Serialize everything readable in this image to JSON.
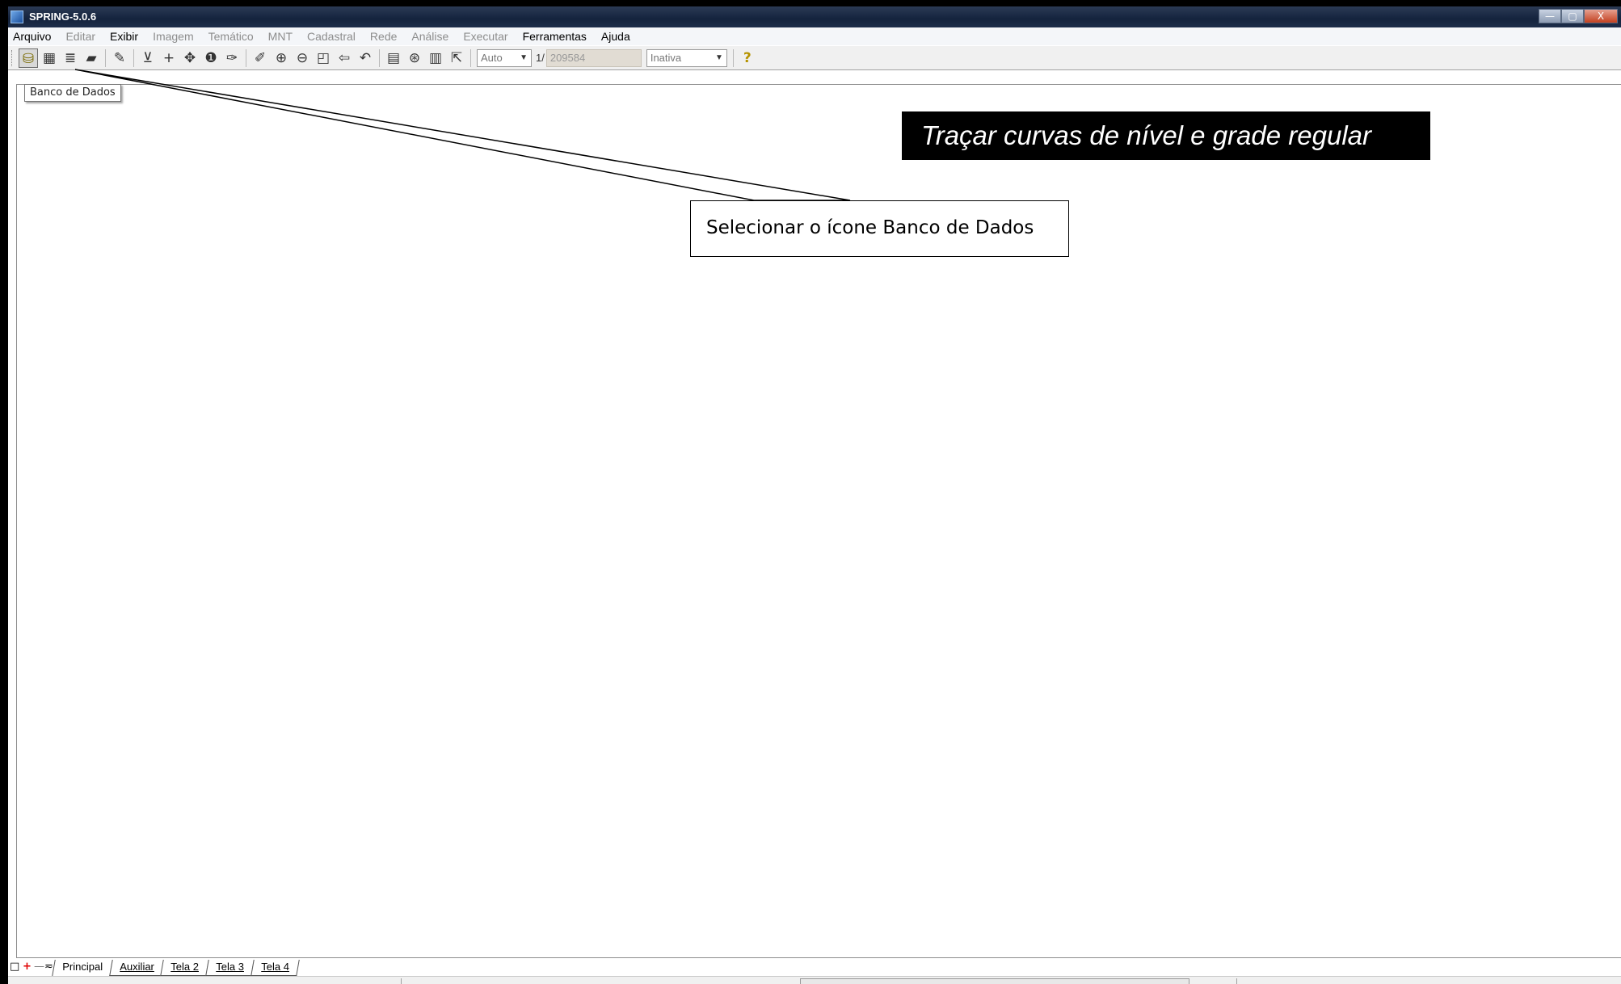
{
  "window": {
    "title": "SPRING-5.0.6",
    "minimize": "—",
    "restore": "▢",
    "close": "X"
  },
  "menu": [
    {
      "label": "Arquivo",
      "enabled": true
    },
    {
      "label": "Editar",
      "enabled": false
    },
    {
      "label": "Exibir",
      "enabled": true
    },
    {
      "label": "Imagem",
      "enabled": false
    },
    {
      "label": "Temático",
      "enabled": false
    },
    {
      "label": "MNT",
      "enabled": false
    },
    {
      "label": "Cadastral",
      "enabled": false
    },
    {
      "label": "Rede",
      "enabled": false
    },
    {
      "label": "Análise",
      "enabled": false
    },
    {
      "label": "Executar",
      "enabled": false
    },
    {
      "label": "Ferramentas",
      "enabled": true
    },
    {
      "label": "Ajuda",
      "enabled": true
    }
  ],
  "toolbar": {
    "icons": {
      "database": "⛁",
      "project": "▦",
      "layers": "≣",
      "eraser": "▰",
      "draw": "✎",
      "save": "⊻",
      "cursor": "+",
      "pan": "✥",
      "info": "❶",
      "tool": "✑",
      "pencil": "✐",
      "zoom_in": "⊕",
      "zoom_out": "⊖",
      "zoom_area": "◰",
      "back": "⇦",
      "undo": "↶",
      "display": "▤",
      "zoom_sel": "⊛",
      "grid": "▥",
      "pointer": "⇱",
      "help": "?"
    },
    "scale_mode": "Auto",
    "scale_prefix": "1/",
    "scale_value": "209584",
    "mode": "Inativa"
  },
  "tooltip": "Banco de Dados",
  "annotations": {
    "banner": "Traçar curvas de nível e grade regular",
    "callout": "Selecionar o ícone Banco de Dados"
  },
  "tabs": {
    "controls": {
      "window": "□",
      "add": "+",
      "remove": "—",
      "link": "≂"
    },
    "items": [
      "Principal",
      "Auxiliar",
      "Tela 2",
      "Tela 3",
      "Tela 4"
    ],
    "active": "Principal"
  },
  "colors": {
    "titlebar": "#14233d",
    "banner_bg": "#000000",
    "banner_text": "#ffffff",
    "add_tab": "#e00000"
  }
}
